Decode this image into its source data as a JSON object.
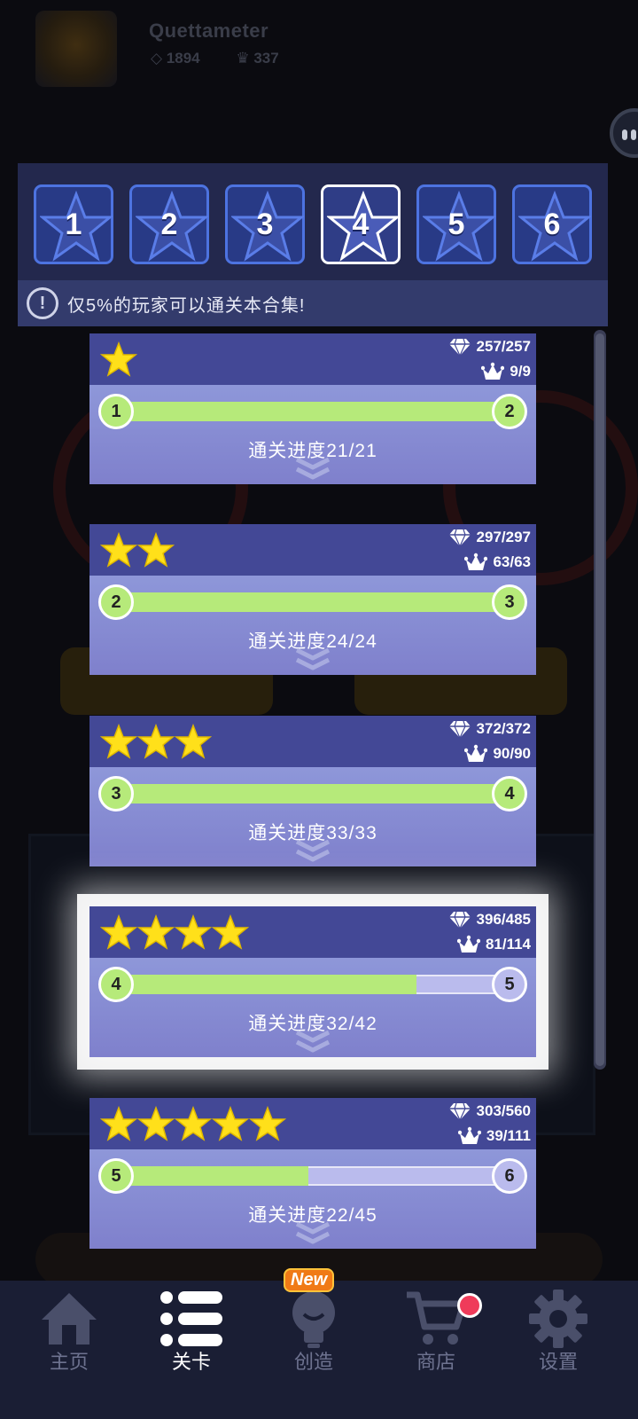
{
  "header": {
    "username": "Quettameter",
    "gems": "1894",
    "crowns": "337"
  },
  "tabs": [
    {
      "label": "1",
      "active": false
    },
    {
      "label": "2",
      "active": false
    },
    {
      "label": "3",
      "active": false
    },
    {
      "label": "4",
      "active": true
    },
    {
      "label": "5",
      "active": false
    },
    {
      "label": "6",
      "active": false
    }
  ],
  "notice": {
    "text": "仅5%的玩家可以通关本合集!"
  },
  "cards": [
    {
      "stars": 1,
      "gems": "257/257",
      "crowns": "9/9",
      "from": "1",
      "to": "2",
      "progress_label": "通关进度21/21",
      "progress": 1.0
    },
    {
      "stars": 2,
      "gems": "297/297",
      "crowns": "63/63",
      "from": "2",
      "to": "3",
      "progress_label": "通关进度24/24",
      "progress": 1.0
    },
    {
      "stars": 3,
      "gems": "372/372",
      "crowns": "90/90",
      "from": "3",
      "to": "4",
      "progress_label": "通关进度33/33",
      "progress": 1.0
    },
    {
      "stars": 4,
      "gems": "396/485",
      "crowns": "81/114",
      "from": "4",
      "to": "5",
      "progress_label": "通关进度32/42",
      "progress": 0.762,
      "highlight": true
    },
    {
      "stars": 5,
      "gems": "303/560",
      "crowns": "39/111",
      "from": "5",
      "to": "6",
      "progress_label": "通关进度22/45",
      "progress": 0.489
    }
  ],
  "nav": {
    "items": [
      {
        "label": "主页",
        "icon": "home-icon",
        "active": false
      },
      {
        "label": "关卡",
        "icon": "level-list-icon",
        "active": true
      },
      {
        "label": "创造",
        "icon": "lightbulb-icon",
        "active": false
      },
      {
        "label": "商店",
        "icon": "cart-icon",
        "active": false
      },
      {
        "label": "设置",
        "icon": "gear-icon",
        "active": false
      }
    ],
    "new_badge": "New"
  },
  "colors": {
    "panel": "#23284d",
    "tab_border": "#4d73e0",
    "card_header": "#434896",
    "progress_fill": "#b6ea7a",
    "star": "#ffe01a",
    "nav_bg": "#1a1e34"
  }
}
